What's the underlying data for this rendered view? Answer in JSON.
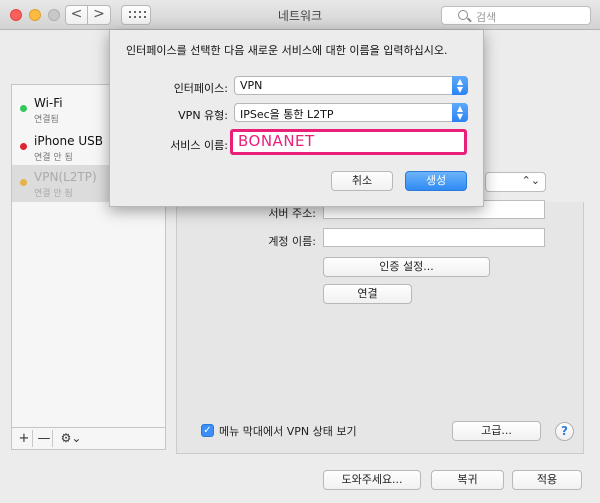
{
  "window": {
    "title": "네트워크",
    "search_placeholder": "검색",
    "nav_back": "<",
    "nav_forward": ">"
  },
  "sidebar": {
    "services": [
      {
        "name": "Wi-Fi",
        "status": "연결됨",
        "dot_color": "#34c759"
      },
      {
        "name": "iPhone USB",
        "status": "연결 안 됨",
        "dot_color": "#e0242f"
      },
      {
        "name": "VPN(L2TP)",
        "status": "연결 안 됨",
        "dot_color": "#e6b24a"
      }
    ],
    "add_label": "+",
    "remove_label": "—",
    "gear_label": "⚙︎⌄"
  },
  "main": {
    "server_label": "서버 주소:",
    "account_label": "계정 이름:",
    "auth_button": "인증 설정...",
    "connect_button": "연결",
    "show_vpn_label": "메뉴 막대에서 VPN 상태 보기",
    "show_vpn_checked": true,
    "advanced_button": "고급...",
    "help_label": "?"
  },
  "footer": {
    "assist_button": "도와주세요...",
    "revert_button": "복귀",
    "apply_button": "적용"
  },
  "dialog": {
    "message": "인터페이스를 선택한 다음 새로운 서비스에 대한 이름을 입력하십시오.",
    "interface_label": "인터페이스:",
    "interface_value": "VPN",
    "vpn_type_label": "VPN 유형:",
    "vpn_type_value": "IPSec을 통한 L2TP",
    "service_name_label": "서비스 이름:",
    "service_name_value": "BONANET",
    "cancel_button": "취소",
    "create_button": "생성"
  },
  "colors": {
    "accent": "#2f8af4",
    "highlight": "#e8207a"
  }
}
